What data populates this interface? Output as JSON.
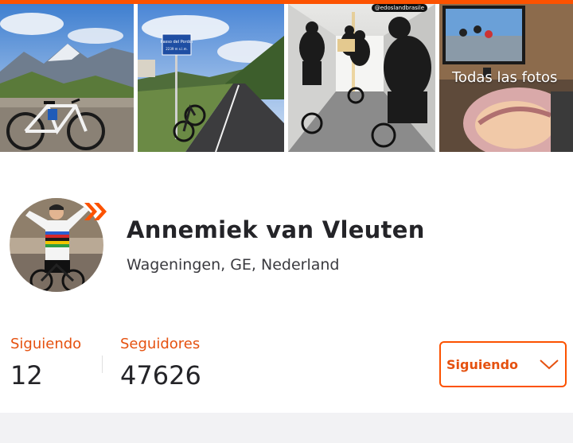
{
  "colors": {
    "accent": "#fc5200",
    "accent_text": "#e5510f",
    "text_primary": "#242428",
    "background_band": "#f2f2f4"
  },
  "gallery": {
    "photos": [
      {
        "subject": "road bike against stone wall with alpine mountains"
      },
      {
        "subject": "bike leaning on mountain pass sign beside road"
      },
      {
        "subject": "group of cyclists riding in a tunnel"
      },
      {
        "subject": "tv showing a cycling race and sleeping baby"
      }
    ],
    "watermark_text": "@edoslandbrasile",
    "sign_text_line1": "Passo del Pordoi",
    "sign_text_line2": "2239 m s.l.m.",
    "all_photos_label": "Todas las fotos"
  },
  "profile": {
    "name": "Annemiek van Vleuten",
    "location": "Wageningen, GE, Nederland",
    "avatar_icon": "athlete-avatar",
    "badge_icon": "subscriber-chevron-icon"
  },
  "stats": {
    "following_label": "Siguiendo",
    "following_value": "12",
    "followers_label": "Seguidores",
    "followers_value": "47626"
  },
  "follow_button": {
    "label": "Siguiendo",
    "icon": "chevron-down-icon"
  }
}
